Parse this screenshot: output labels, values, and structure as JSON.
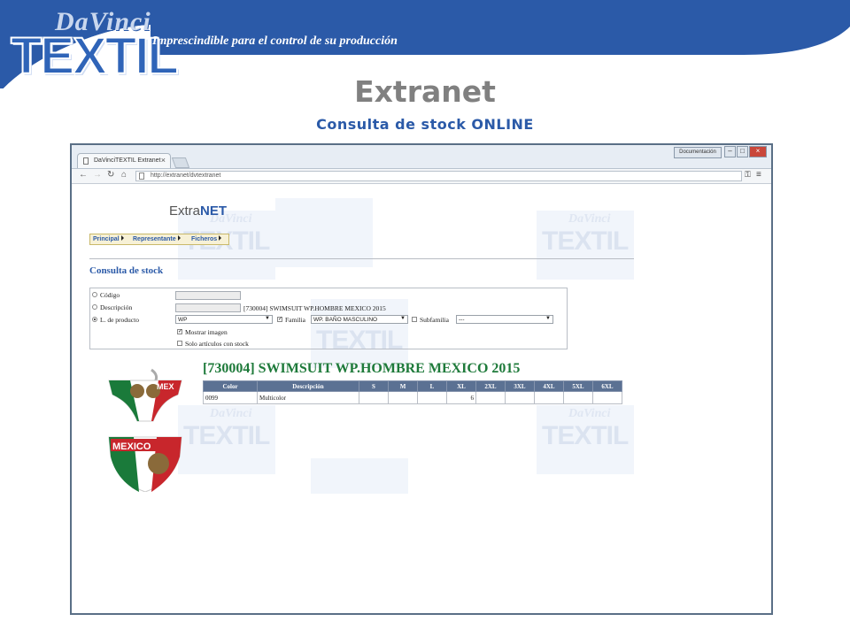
{
  "slide": {
    "logo_top": "DaVinci",
    "logo_main": "TEXTIL",
    "tagline": "Imprescindible para el control de su producción",
    "title": "Extranet",
    "subtitle": "Consulta de stock ONLINE"
  },
  "browser": {
    "tab_title": "DaVinciTEXTIL Extranet",
    "url": "http://extranet/dvtextranet",
    "doc_button": "Documentación",
    "icons": [
      "back-icon",
      "forward-icon",
      "reload-icon",
      "home-icon",
      "key-icon",
      "menu-icon"
    ]
  },
  "page": {
    "logo_prefix": "Extra",
    "logo_suffix": "NET",
    "menu": [
      "Principal",
      "Representante",
      "Ficheros"
    ],
    "section_title": "Consulta de stock",
    "watermark_top": "DaVinci",
    "watermark_main": "TEXTIL"
  },
  "form": {
    "codigo_label": "Código",
    "descripcion_label": "Descripción",
    "descripcion_value": "[730004] SWIMSUIT WP.HOMBRE MEXICO 2015",
    "linea_label": "L. de producto",
    "linea_value": "WP",
    "familia_label": "Familia",
    "familia_value": "WP. BAÑO MASCULINO",
    "subfamilia_label": "Subfamilia",
    "subfamilia_value": "---",
    "mostrar_imagen_label": "Mostrar imagen",
    "solo_stock_label": "Solo artículos con stock",
    "selected_radio": "linea",
    "mostrar_imagen_checked": true,
    "familia_checked": true,
    "subfamilia_checked": false,
    "solo_stock_checked": false
  },
  "product": {
    "title": "[730004] SWIMSUIT WP.HOMBRE MEXICO 2015",
    "image_text_top": "MEX",
    "image_text_bottom": "MEXICO",
    "table": {
      "headers": [
        "Color",
        "Descripción",
        "S",
        "M",
        "L",
        "XL",
        "2XL",
        "3XL",
        "4XL",
        "5XL",
        "6XL"
      ],
      "rows": [
        [
          "0099",
          "Multicolor",
          "",
          "",
          "",
          "6",
          "",
          "",
          "",
          "",
          ""
        ]
      ]
    }
  },
  "colors": {
    "brand_blue": "#2b5aa8",
    "title_gray": "#808080",
    "product_green": "#1e7a3a",
    "table_header": "#5b7193"
  }
}
